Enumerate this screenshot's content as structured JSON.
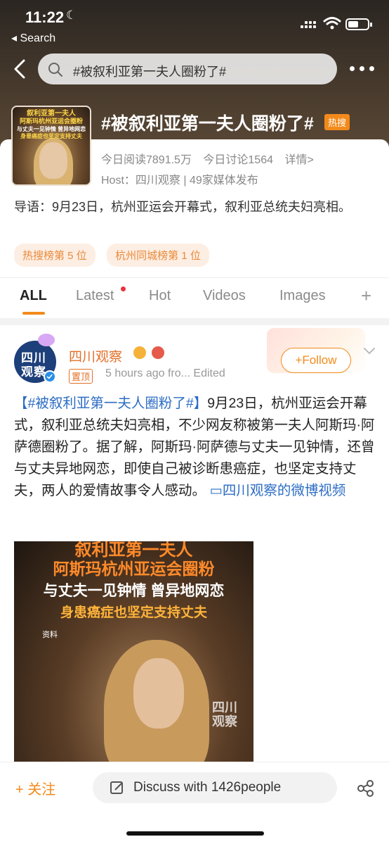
{
  "status_bar": {
    "time": "11:22",
    "back_app": "◂ Search"
  },
  "search": {
    "query": "#被叙利亚第一夫人圈粉了#"
  },
  "topic": {
    "title": "#被叙利亚第一夫人圈粉了#",
    "hot_badge": "热搜",
    "cover_lines": [
      "叙利亚第一夫人",
      "阿斯玛杭州亚运会圈粉",
      "与丈夫一见钟情 曾异地网恋",
      "身患癌症也坚定支持丈夫"
    ],
    "stats": {
      "reads": "今日阅读7891.5万",
      "discussions": "今日讨论1564",
      "details": "详情>"
    },
    "host": "Host：四川观察 | 49家媒体发布",
    "intro": "导语：9月23日，杭州亚运会开幕式，叙利亚总统夫妇亮相。",
    "tags": [
      "热搜榜第 5 位",
      "杭州同城榜第 1 位"
    ]
  },
  "tabs": {
    "items": [
      "ALL",
      "Latest",
      "Hot",
      "Videos",
      "Images"
    ],
    "add": "+"
  },
  "post": {
    "avatar_lines": [
      "四川",
      "观察"
    ],
    "username": "四川观察",
    "pinned": "置顶",
    "meta": "5 hours ago  fro...  Edited",
    "follow": "+Follow",
    "hashtag": "【#被叙利亚第一夫人圈粉了#】",
    "body": "9月23日，杭州亚运会开幕式，叙利亚总统夫妇亮相，不少网友称被第一夫人阿斯玛·阿萨德圈粉了。据了解，阿斯玛·阿萨德与丈夫一见钟情，还曾与丈夫异地网恋，即使自己被诊断患癌症，也坚定支持丈夫，两人的爱情故事令人感动。",
    "video_link": "▭四川观察的微博视频",
    "image_lines": [
      "叙利亚第一夫人",
      "阿斯玛杭州亚运会圈粉",
      "与丈夫一见钟情 曾异地网恋",
      "身患癌症也坚定支持丈夫",
      "资料"
    ],
    "image_watermark": [
      "四川",
      "观察"
    ]
  },
  "bottom_bar": {
    "follow": "+ 关注",
    "discuss": "Discuss with 1426people"
  },
  "colors": {
    "accent": "#f28a1b",
    "link": "#2b6cc4",
    "username": "#e3702a"
  }
}
